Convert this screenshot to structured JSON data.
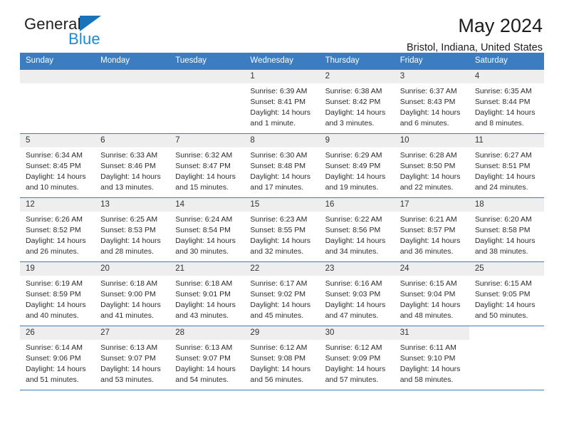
{
  "brand": {
    "name_line1": "General",
    "name_line2": "Blue",
    "logo_icon": "triangle-logo-icon",
    "blue": "#1a8ad4",
    "dark": "#231f20"
  },
  "header": {
    "title": "May 2024",
    "subtitle": "Bristol, Indiana, United States"
  },
  "calendar": {
    "header_bg": "#3b7dc0",
    "daynum_bg": "#eeeeee",
    "weekdays": [
      "Sunday",
      "Monday",
      "Tuesday",
      "Wednesday",
      "Thursday",
      "Friday",
      "Saturday"
    ],
    "weeks": [
      [
        {
          "day": "",
          "blank": true
        },
        {
          "day": "",
          "blank": true
        },
        {
          "day": "",
          "blank": true
        },
        {
          "day": "1",
          "sunrise": "Sunrise: 6:39 AM",
          "sunset": "Sunset: 8:41 PM",
          "daylight": "Daylight: 14 hours and 1 minute."
        },
        {
          "day": "2",
          "sunrise": "Sunrise: 6:38 AM",
          "sunset": "Sunset: 8:42 PM",
          "daylight": "Daylight: 14 hours and 3 minutes."
        },
        {
          "day": "3",
          "sunrise": "Sunrise: 6:37 AM",
          "sunset": "Sunset: 8:43 PM",
          "daylight": "Daylight: 14 hours and 6 minutes."
        },
        {
          "day": "4",
          "sunrise": "Sunrise: 6:35 AM",
          "sunset": "Sunset: 8:44 PM",
          "daylight": "Daylight: 14 hours and 8 minutes."
        }
      ],
      [
        {
          "day": "5",
          "sunrise": "Sunrise: 6:34 AM",
          "sunset": "Sunset: 8:45 PM",
          "daylight": "Daylight: 14 hours and 10 minutes."
        },
        {
          "day": "6",
          "sunrise": "Sunrise: 6:33 AM",
          "sunset": "Sunset: 8:46 PM",
          "daylight": "Daylight: 14 hours and 13 minutes."
        },
        {
          "day": "7",
          "sunrise": "Sunrise: 6:32 AM",
          "sunset": "Sunset: 8:47 PM",
          "daylight": "Daylight: 14 hours and 15 minutes."
        },
        {
          "day": "8",
          "sunrise": "Sunrise: 6:30 AM",
          "sunset": "Sunset: 8:48 PM",
          "daylight": "Daylight: 14 hours and 17 minutes."
        },
        {
          "day": "9",
          "sunrise": "Sunrise: 6:29 AM",
          "sunset": "Sunset: 8:49 PM",
          "daylight": "Daylight: 14 hours and 19 minutes."
        },
        {
          "day": "10",
          "sunrise": "Sunrise: 6:28 AM",
          "sunset": "Sunset: 8:50 PM",
          "daylight": "Daylight: 14 hours and 22 minutes."
        },
        {
          "day": "11",
          "sunrise": "Sunrise: 6:27 AM",
          "sunset": "Sunset: 8:51 PM",
          "daylight": "Daylight: 14 hours and 24 minutes."
        }
      ],
      [
        {
          "day": "12",
          "sunrise": "Sunrise: 6:26 AM",
          "sunset": "Sunset: 8:52 PM",
          "daylight": "Daylight: 14 hours and 26 minutes."
        },
        {
          "day": "13",
          "sunrise": "Sunrise: 6:25 AM",
          "sunset": "Sunset: 8:53 PM",
          "daylight": "Daylight: 14 hours and 28 minutes."
        },
        {
          "day": "14",
          "sunrise": "Sunrise: 6:24 AM",
          "sunset": "Sunset: 8:54 PM",
          "daylight": "Daylight: 14 hours and 30 minutes."
        },
        {
          "day": "15",
          "sunrise": "Sunrise: 6:23 AM",
          "sunset": "Sunset: 8:55 PM",
          "daylight": "Daylight: 14 hours and 32 minutes."
        },
        {
          "day": "16",
          "sunrise": "Sunrise: 6:22 AM",
          "sunset": "Sunset: 8:56 PM",
          "daylight": "Daylight: 14 hours and 34 minutes."
        },
        {
          "day": "17",
          "sunrise": "Sunrise: 6:21 AM",
          "sunset": "Sunset: 8:57 PM",
          "daylight": "Daylight: 14 hours and 36 minutes."
        },
        {
          "day": "18",
          "sunrise": "Sunrise: 6:20 AM",
          "sunset": "Sunset: 8:58 PM",
          "daylight": "Daylight: 14 hours and 38 minutes."
        }
      ],
      [
        {
          "day": "19",
          "sunrise": "Sunrise: 6:19 AM",
          "sunset": "Sunset: 8:59 PM",
          "daylight": "Daylight: 14 hours and 40 minutes."
        },
        {
          "day": "20",
          "sunrise": "Sunrise: 6:18 AM",
          "sunset": "Sunset: 9:00 PM",
          "daylight": "Daylight: 14 hours and 41 minutes."
        },
        {
          "day": "21",
          "sunrise": "Sunrise: 6:18 AM",
          "sunset": "Sunset: 9:01 PM",
          "daylight": "Daylight: 14 hours and 43 minutes."
        },
        {
          "day": "22",
          "sunrise": "Sunrise: 6:17 AM",
          "sunset": "Sunset: 9:02 PM",
          "daylight": "Daylight: 14 hours and 45 minutes."
        },
        {
          "day": "23",
          "sunrise": "Sunrise: 6:16 AM",
          "sunset": "Sunset: 9:03 PM",
          "daylight": "Daylight: 14 hours and 47 minutes."
        },
        {
          "day": "24",
          "sunrise": "Sunrise: 6:15 AM",
          "sunset": "Sunset: 9:04 PM",
          "daylight": "Daylight: 14 hours and 48 minutes."
        },
        {
          "day": "25",
          "sunrise": "Sunrise: 6:15 AM",
          "sunset": "Sunset: 9:05 PM",
          "daylight": "Daylight: 14 hours and 50 minutes."
        }
      ],
      [
        {
          "day": "26",
          "sunrise": "Sunrise: 6:14 AM",
          "sunset": "Sunset: 9:06 PM",
          "daylight": "Daylight: 14 hours and 51 minutes."
        },
        {
          "day": "27",
          "sunrise": "Sunrise: 6:13 AM",
          "sunset": "Sunset: 9:07 PM",
          "daylight": "Daylight: 14 hours and 53 minutes."
        },
        {
          "day": "28",
          "sunrise": "Sunrise: 6:13 AM",
          "sunset": "Sunset: 9:07 PM",
          "daylight": "Daylight: 14 hours and 54 minutes."
        },
        {
          "day": "29",
          "sunrise": "Sunrise: 6:12 AM",
          "sunset": "Sunset: 9:08 PM",
          "daylight": "Daylight: 14 hours and 56 minutes."
        },
        {
          "day": "30",
          "sunrise": "Sunrise: 6:12 AM",
          "sunset": "Sunset: 9:09 PM",
          "daylight": "Daylight: 14 hours and 57 minutes."
        },
        {
          "day": "31",
          "sunrise": "Sunrise: 6:11 AM",
          "sunset": "Sunset: 9:10 PM",
          "daylight": "Daylight: 14 hours and 58 minutes."
        },
        {
          "day": "",
          "empty": true
        }
      ]
    ]
  }
}
